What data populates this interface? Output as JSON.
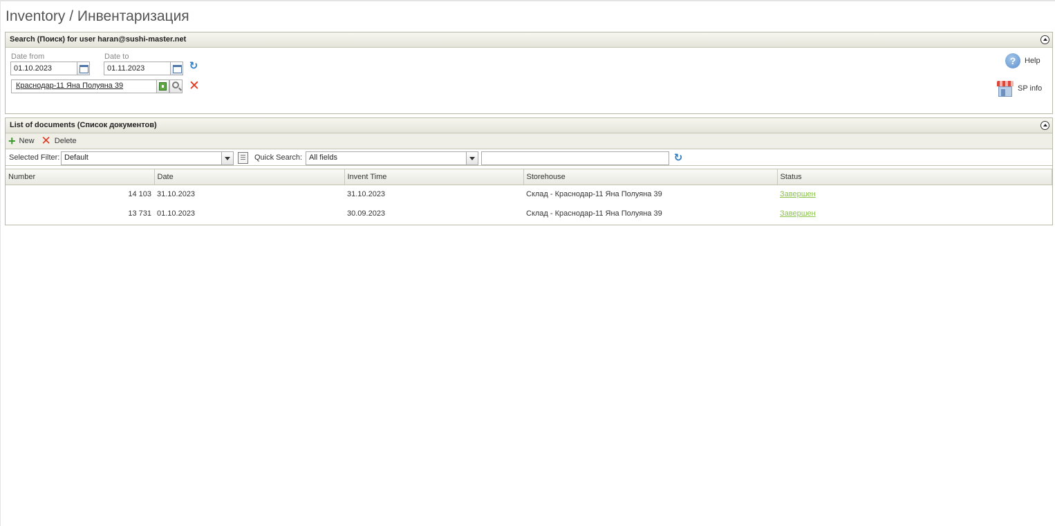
{
  "page": {
    "title": "Inventory / Инвентаризация"
  },
  "search_panel": {
    "title": "Search (Поиск) for user haran@sushi-master.net",
    "date_from_label": "Date from",
    "date_from_value": "01.10.2023",
    "date_to_label": "Date to",
    "date_to_value": "01.11.2023",
    "storehouse_value": "Краснодар-11 Яна Полуяна 39",
    "help_label": "Help",
    "sp_info_label": "SP info"
  },
  "documents_panel": {
    "title": "List of documents (Список документов)",
    "toolbar": {
      "new_label": "New",
      "delete_label": "Delete"
    },
    "filter": {
      "selected_filter_label": "Selected Filter:",
      "selected_filter_value": "Default",
      "quick_search_label": "Quick Search:",
      "quick_search_field": "All fields",
      "quick_search_text": ""
    },
    "columns": [
      "Number",
      "Date",
      "Invent Time",
      "Storehouse",
      "Status"
    ],
    "rows": [
      {
        "number": "14 103",
        "date": "31.10.2023",
        "invent_time": "31.10.2023",
        "storehouse": "Склад - Краснодар-11 Яна Полуяна 39",
        "status": "Завершен"
      },
      {
        "number": "13 731",
        "date": "01.10.2023",
        "invent_time": "30.09.2023",
        "storehouse": "Склад - Краснодар-11 Яна Полуяна 39",
        "status": "Завершен"
      }
    ]
  },
  "colors": {
    "status_link": "#8bc34a",
    "delete_red": "#e0361d",
    "add_green": "#3a9a2a",
    "panel_border": "#b7b9a6"
  },
  "icons": [
    "calendar-icon",
    "refresh-icon",
    "tree-select-icon",
    "search-icon",
    "clear-icon",
    "help-icon",
    "shop-icon",
    "add-icon",
    "delete-icon",
    "filter-icon",
    "chevron-up-icon",
    "dropdown-arrow-icon"
  ]
}
